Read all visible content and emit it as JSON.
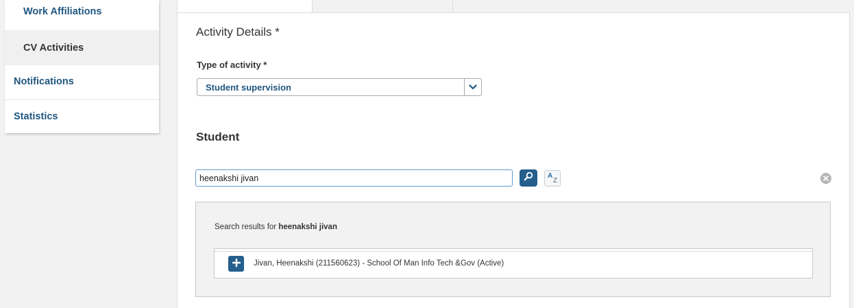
{
  "sidebar": {
    "items": [
      {
        "label": "Work Affiliations"
      },
      {
        "label": "CV Activities"
      },
      {
        "label": "Notifications"
      },
      {
        "label": "Statistics"
      }
    ]
  },
  "activity": {
    "section_title": "Activity Details *",
    "type_label": "Type of activity *",
    "type_value": "Student supervision"
  },
  "student": {
    "title": "Student",
    "search_value": "heenakshi jivan"
  },
  "results": {
    "prefix": "Search results for ",
    "query": "heenakshi jivan",
    "items": [
      {
        "label": "Jivan, Heenakshi (211560623) - School Of Man Info Tech &Gov (Active)"
      }
    ]
  },
  "colors": {
    "link": "#1f5680",
    "button": "#245f8e",
    "input_focus": "#5b9bd5"
  },
  "icons": {
    "select": "chevron-down-icon",
    "search": "magnifier-icon",
    "sort": "a-z-sort-icon",
    "clear": "close-circle-icon",
    "add": "plus-icon"
  }
}
